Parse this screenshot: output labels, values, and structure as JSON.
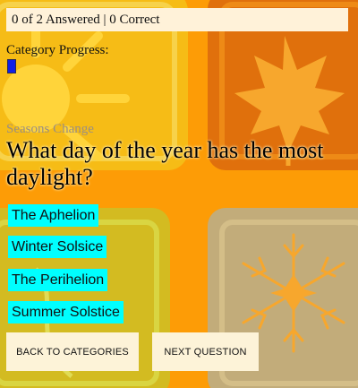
{
  "score": {
    "text": "0 of 2 Answered | 0 Correct"
  },
  "progress": {
    "label": "Category Progress:",
    "value": 0
  },
  "category": {
    "name": "Seasons Change"
  },
  "question": {
    "text": "What day of the year has the most daylight?"
  },
  "answers": [
    {
      "label": "The Aphelion"
    },
    {
      "label": "Winter Solsice"
    },
    {
      "label": "The Perihelion"
    },
    {
      "label": "Summer Solstice"
    }
  ],
  "buttons": {
    "back": "BACK TO CATEGORIES",
    "next": "NEXT QUESTION"
  },
  "colors": {
    "background": "#fd9c06",
    "answer_bg": "#00ffff",
    "progress_fill": "#1020e6"
  }
}
